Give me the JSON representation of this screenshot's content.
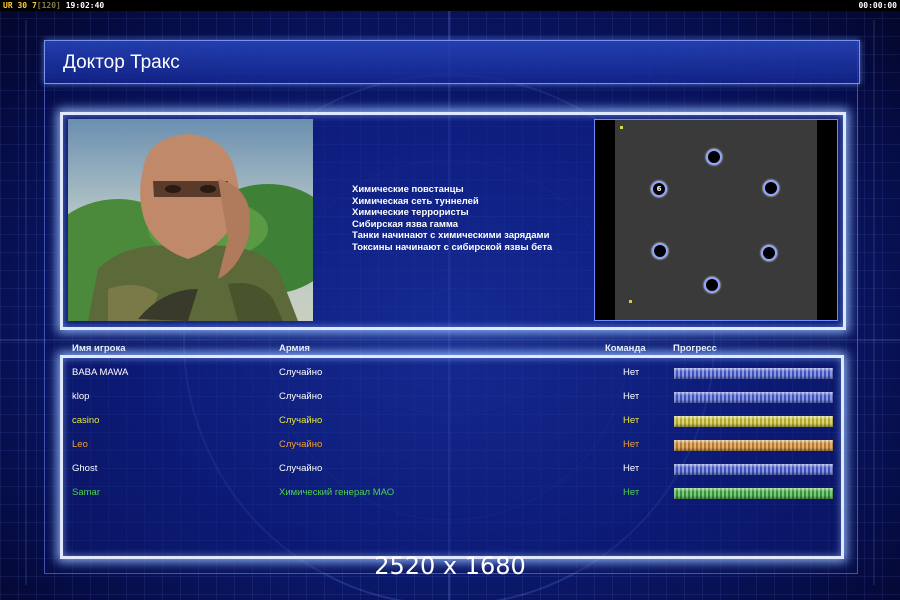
{
  "hud": {
    "ur_label": "UR",
    "fps": "30",
    "fps_marker": "7",
    "frames": "[120]",
    "clock": "19:02:40",
    "timer": "00:00:00"
  },
  "screen": {
    "title": "Доктор Тракс",
    "briefing": [
      "Химические повстанцы",
      "Химическая сеть туннелей",
      "Химические террористы",
      "Сибирская язва гамма",
      "Танки начинают с химическими зарядами",
      "Токсины начинают с сибирской язвы бета"
    ]
  },
  "minimap": {
    "start_positions": [
      {
        "label": ""
      },
      {
        "label": "6"
      },
      {
        "label": ""
      },
      {
        "label": ""
      },
      {
        "label": ""
      },
      {
        "label": ""
      }
    ],
    "field_color": "#3a3a3a"
  },
  "table": {
    "headers": {
      "player": "Имя игрока",
      "army": "Армия",
      "team": "Команда",
      "progress": "Прогресс"
    },
    "rows": [
      {
        "name": "BABA MAWA",
        "army": "Случайно",
        "team": "Нет",
        "color": "#ffffff",
        "bar": "#4a5fd6"
      },
      {
        "name": "klop",
        "army": "Случайно",
        "team": "Нет",
        "color": "#ffffff",
        "bar": "#4a5fd6"
      },
      {
        "name": "casino",
        "army": "Случайно",
        "team": "Нет",
        "color": "#e8e83a",
        "bar": "#c8c030"
      },
      {
        "name": "Leo",
        "army": "Случайно",
        "team": "Нет",
        "color": "#f0a030",
        "bar": "#d08a30"
      },
      {
        "name": "Ghost",
        "army": "Случайно",
        "team": "Нет",
        "color": "#ffffff",
        "bar": "#4a5fd6"
      },
      {
        "name": "Samar",
        "army": "Химический генерал МАО",
        "team": "Нет",
        "color": "#4cd24c",
        "bar": "#3aaa3a"
      }
    ]
  },
  "watermark": "2520 x 1680"
}
